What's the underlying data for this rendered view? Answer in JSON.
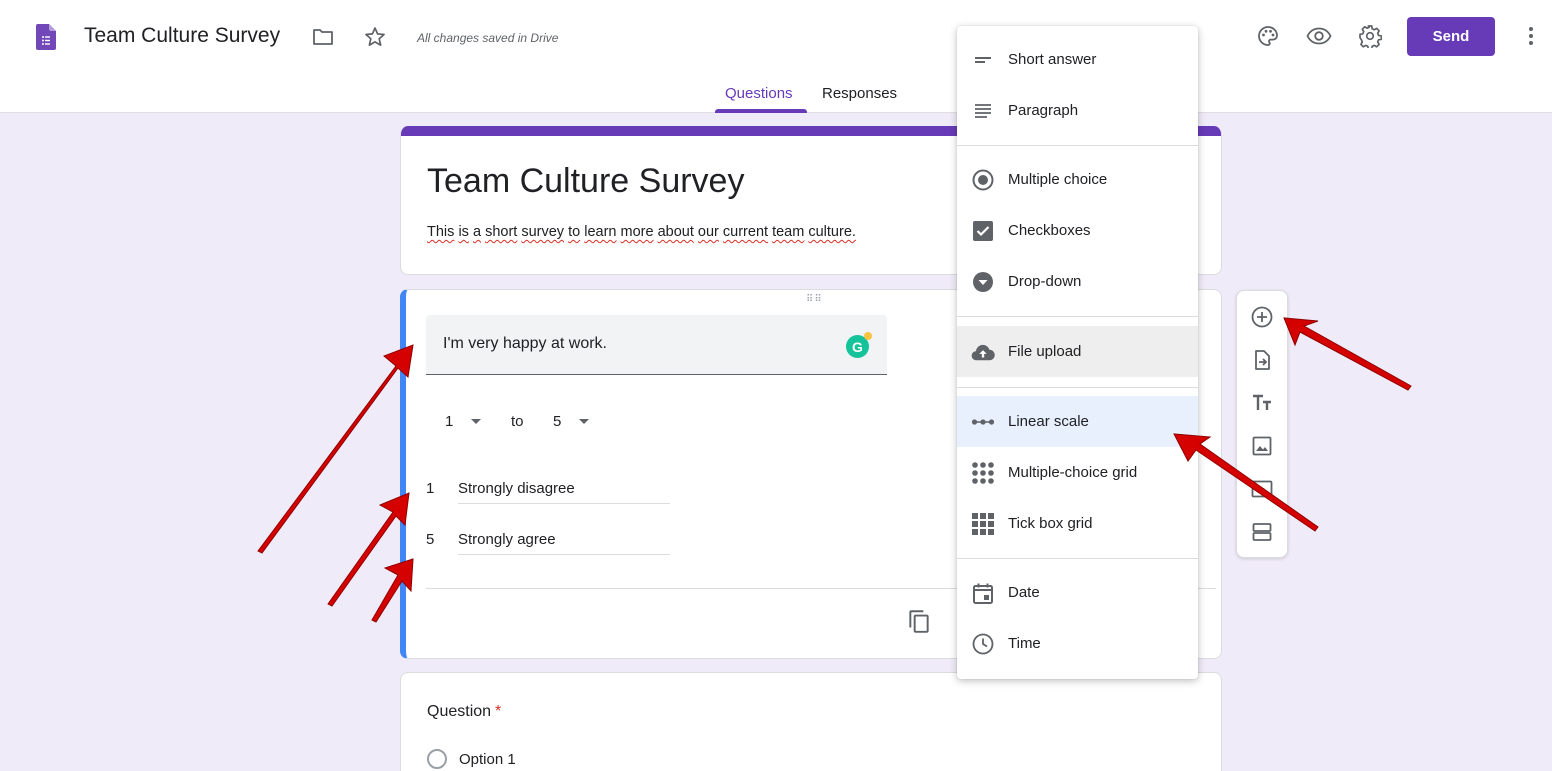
{
  "header": {
    "title": "Team Culture Survey",
    "save_status": "All changes saved in Drive",
    "send_label": "Send",
    "icons": [
      "forms-doc-icon",
      "folder-icon",
      "star-icon",
      "palette-icon",
      "eye-icon",
      "gear-icon",
      "more-vert-icon"
    ],
    "accent_color": "#673ab7"
  },
  "tabs": [
    {
      "label": "Questions",
      "active": true
    },
    {
      "label": "Responses",
      "active": false
    }
  ],
  "form": {
    "title": "Team Culture Survey",
    "description_words": [
      "This",
      "is",
      "a",
      "short",
      "survey",
      "to",
      "learn",
      "more",
      "about",
      "our",
      "current",
      "team",
      "culture."
    ]
  },
  "question": {
    "text": "I'm very happy at work.",
    "scale_from": "1",
    "scale_to_word": "to",
    "scale_to": "5",
    "low_num": "1",
    "low_label": "Strongly disagree",
    "high_num": "5",
    "high_label": "Strongly agree"
  },
  "question2": {
    "label": "Question",
    "required_mark": "*",
    "option1": "Option 1"
  },
  "menu": {
    "items": [
      {
        "label": "Short answer",
        "icon": "short-text-icon"
      },
      {
        "label": "Paragraph",
        "icon": "paragraph-icon"
      },
      {
        "label": "Multiple choice",
        "icon": "radio-button-icon"
      },
      {
        "label": "Checkboxes",
        "icon": "checkbox-icon"
      },
      {
        "label": "Drop-down",
        "icon": "dropdown-circle-icon"
      },
      {
        "label": "File upload",
        "icon": "cloud-upload-icon"
      },
      {
        "label": "Linear scale",
        "icon": "linear-scale-icon"
      },
      {
        "label": "Multiple-choice grid",
        "icon": "dot-grid-icon"
      },
      {
        "label": "Tick box grid",
        "icon": "square-grid-icon"
      },
      {
        "label": "Date",
        "icon": "calendar-icon"
      },
      {
        "label": "Time",
        "icon": "clock-icon"
      }
    ],
    "hovered": "File upload",
    "selected": "Linear scale"
  },
  "toolbar": {
    "icons": [
      "add-question-icon",
      "import-questions-icon",
      "add-title-icon",
      "add-image-icon",
      "add-video-icon",
      "add-section-icon"
    ]
  },
  "annotation_color": "#d50000"
}
